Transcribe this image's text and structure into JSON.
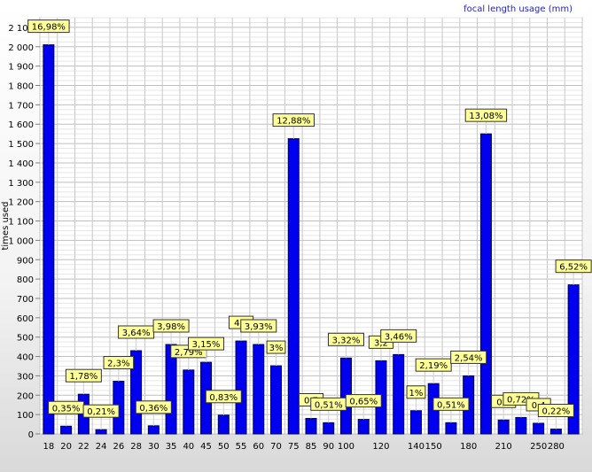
{
  "chart_data": {
    "type": "bar",
    "title": "focal length usage (mm)",
    "ylabel": "times used",
    "xlabel": "",
    "ylim": [
      0,
      2150
    ],
    "y_ticks": [
      0,
      100,
      200,
      300,
      400,
      500,
      600,
      700,
      800,
      900,
      1000,
      1100,
      1200,
      1300,
      1400,
      1500,
      1600,
      1700,
      1800,
      1900,
      2000,
      2100
    ],
    "y_tick_labels": [
      "0",
      "100",
      "200",
      "300",
      "400",
      "500",
      "600",
      "700",
      "800",
      "900",
      "1 000",
      "1 100",
      "1 200",
      "1 300",
      "1 400",
      "1 500",
      "1 600",
      "1 700",
      "1 800",
      "1 900",
      "2 000",
      "2 100"
    ],
    "x_tick_labels": [
      "18",
      "20",
      "22",
      "24",
      "26",
      "28",
      "30",
      "35",
      "40",
      "45",
      "50",
      "55",
      "60",
      "70",
      "75",
      "85",
      "90",
      "100",
      "120",
      "140",
      "150",
      "180",
      "210",
      "250",
      "280"
    ],
    "values": [
      2010,
      40,
      205,
      22,
      272,
      430,
      42,
      462,
      330,
      370,
      97,
      480,
      462,
      352,
      1525,
      80,
      58,
      392,
      75,
      378,
      410,
      120,
      260,
      58,
      300,
      1550,
      72,
      85,
      55,
      25,
      770
    ],
    "data_labels": [
      "16,98%",
      "0,35%",
      "1,78%",
      "0,21%",
      "2,3%",
      "3,64%",
      "0,36%",
      "3,98%",
      "2,79%",
      "3,15%",
      "0,83%",
      "4,0",
      "3,93%",
      "3%",
      "12,88%",
      "0,7",
      "0,51%",
      "3,32%",
      "0,65%",
      "3,2",
      "3,46%",
      "1%",
      "2,19%",
      "0,51%",
      "2,54%",
      "13,08%",
      "0,6",
      "0,72%",
      "0,4",
      "0,22%",
      "6,52%"
    ],
    "grid": true,
    "bar_color": "#0000ee",
    "label_bg": "#ffff99",
    "title_color": "#1f1fbf"
  }
}
